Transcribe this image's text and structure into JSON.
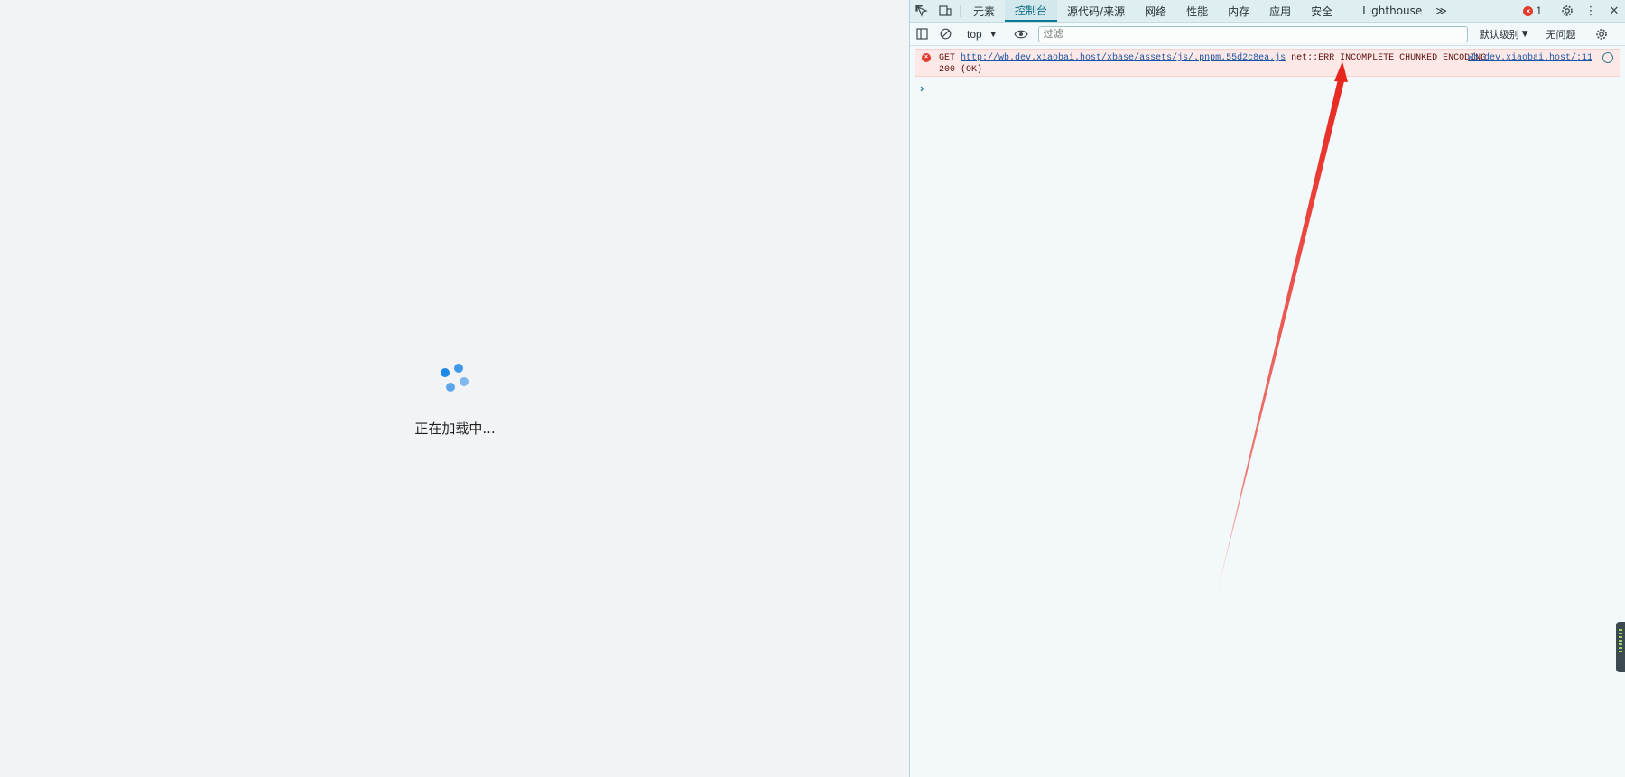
{
  "page": {
    "loading_text": "正在加载中...",
    "spinner_color": "#1e88e5"
  },
  "devtools": {
    "tabs": [
      {
        "label": "元素",
        "active": false
      },
      {
        "label": "控制台",
        "active": true
      },
      {
        "label": "源代码/来源",
        "active": false
      },
      {
        "label": "网络",
        "active": false
      },
      {
        "label": "性能",
        "active": false
      },
      {
        "label": "内存",
        "active": false
      },
      {
        "label": "应用",
        "active": false
      },
      {
        "label": "安全",
        "active": false
      },
      {
        "label": "Lighthouse",
        "active": false
      }
    ],
    "more_tabs": "≫",
    "error_count": "1",
    "toolbar": {
      "context": "top",
      "filter_placeholder": "过滤",
      "levels": "默认级别",
      "issues": "无问题"
    },
    "console": {
      "error": {
        "method": "GET",
        "url": "http://wb.dev.xiaobai.host/xbase/assets/js/.pnpm.55d2c8ea.js",
        "message": "net::ERR_INCOMPLETE_CHUNKED_ENCODING",
        "status": "200 (OK)",
        "source": "wb.dev.xiaobai.host/:11"
      },
      "prompt": "›"
    },
    "annotation_color": "#e8251c"
  }
}
